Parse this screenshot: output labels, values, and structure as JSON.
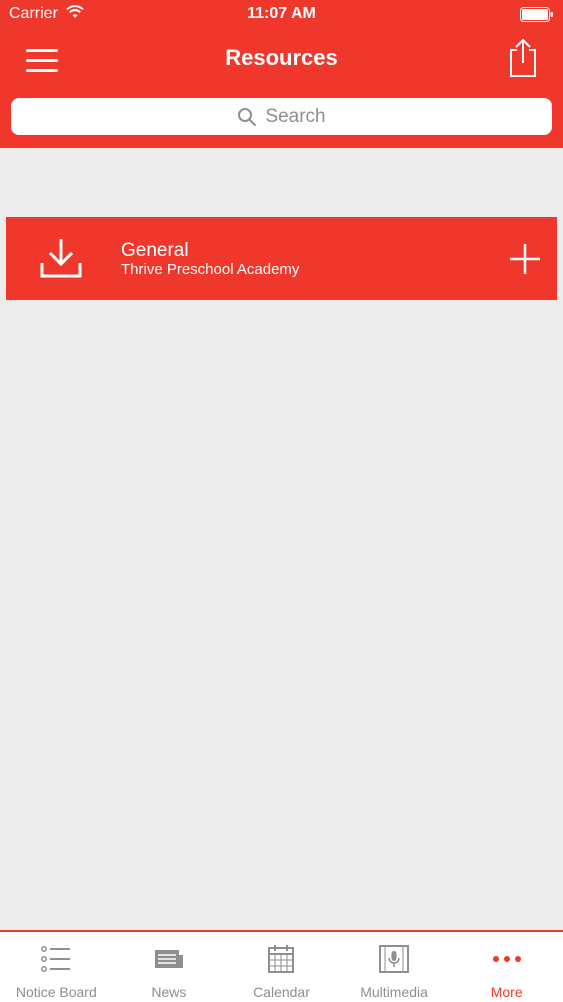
{
  "status": {
    "carrier": "Carrier",
    "time": "11:07 AM"
  },
  "header": {
    "title": "Resources"
  },
  "search": {
    "placeholder": "Search"
  },
  "resources": [
    {
      "title": "General",
      "subtitle": "Thrive Preschool Academy"
    }
  ],
  "tabs": [
    {
      "label": "Notice Board",
      "icon": "list-icon"
    },
    {
      "label": "News",
      "icon": "news-icon"
    },
    {
      "label": "Calendar",
      "icon": "calendar-icon"
    },
    {
      "label": "Multimedia",
      "icon": "multimedia-icon"
    },
    {
      "label": "More",
      "icon": "more-icon",
      "active": true
    }
  ],
  "colors": {
    "accent": "#f0372b",
    "background": "#ececec",
    "inactive": "#8e8e93"
  }
}
